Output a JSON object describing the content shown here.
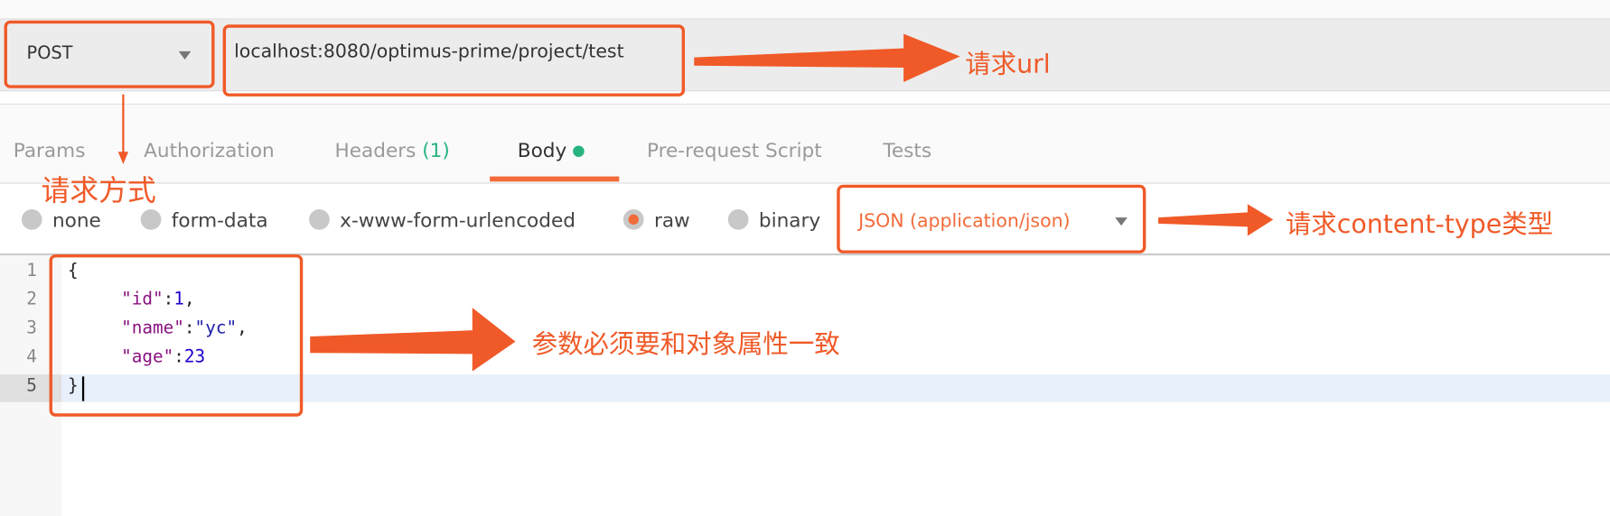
{
  "request": {
    "method": "POST",
    "url": "localhost:8080/optimus-prime/project/test"
  },
  "tabs": [
    {
      "label": "Params"
    },
    {
      "label": "Authorization"
    },
    {
      "label": "Headers",
      "count": "(1)"
    },
    {
      "label": "Body",
      "active": true
    },
    {
      "label": "Pre-request Script"
    },
    {
      "label": "Tests"
    }
  ],
  "body_modes": [
    {
      "label": "none",
      "selected": false
    },
    {
      "label": "form-data",
      "selected": false
    },
    {
      "label": "x-www-form-urlencoded",
      "selected": false
    },
    {
      "label": "raw",
      "selected": true
    },
    {
      "label": "binary",
      "selected": false
    }
  ],
  "content_type": "JSON (application/json)",
  "editor": {
    "line_numbers": [
      "1",
      "2",
      "3",
      "4",
      "5"
    ],
    "lines": [
      {
        "open": "{"
      },
      {
        "key": "\"id\"",
        "sep": ":",
        "value": "1",
        "end": ","
      },
      {
        "key": "\"name\"",
        "sep": ":",
        "value": "\"yc\"",
        "end": ","
      },
      {
        "key": "\"age\"",
        "sep": ":",
        "value": "23",
        "end": ""
      },
      {
        "close": "}"
      }
    ],
    "active_line": 5
  },
  "annotations": {
    "url": "请求url",
    "method": "请求方式",
    "content_type": "请求content-type类型",
    "params": "参数必须要和对象属性一致"
  },
  "colors": {
    "accent": "#f26b3a",
    "annotation": "#f05a28",
    "success": "#26b47f"
  }
}
